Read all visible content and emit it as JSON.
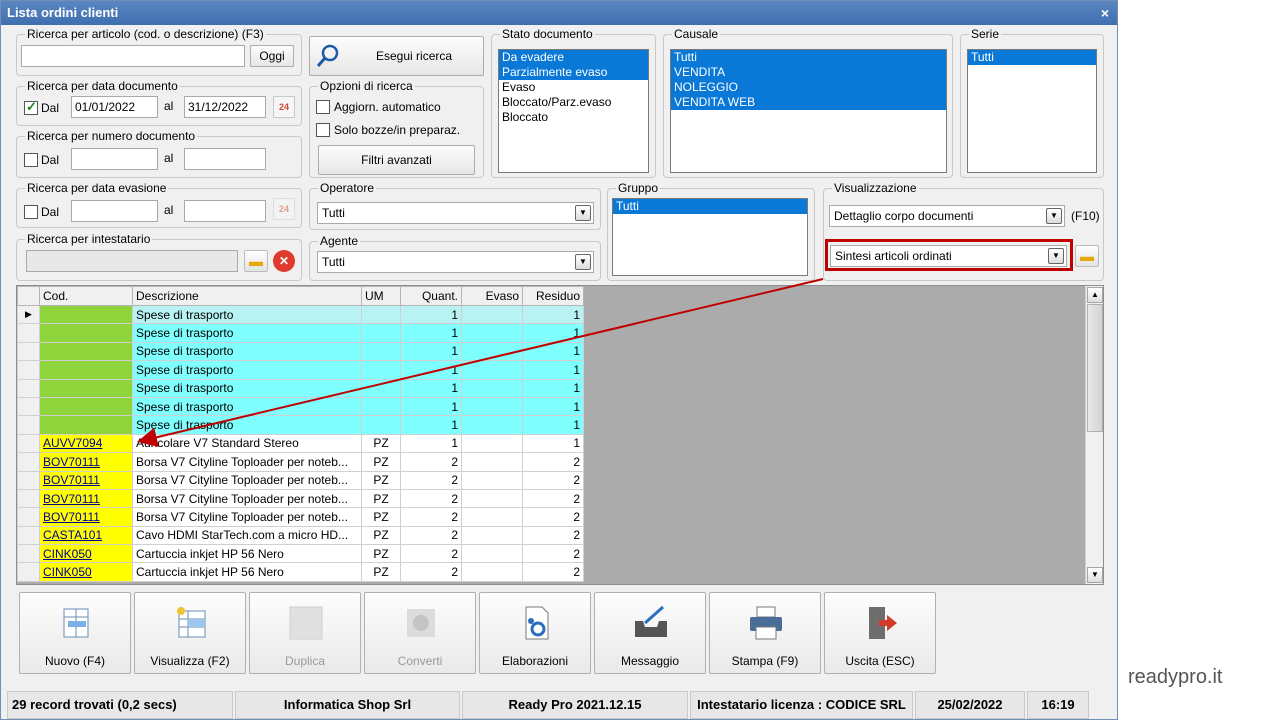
{
  "window": {
    "title": "Lista ordini clienti",
    "close": "×"
  },
  "ricerca_articolo": {
    "legend": "Ricerca per articolo (cod. o descrizione) (F3)",
    "value": "",
    "button": "Oggi"
  },
  "esegui": {
    "label": "Esegui ricerca"
  },
  "data_documento": {
    "legend": "Ricerca per data documento",
    "chk_label": "Dal",
    "checked": true,
    "from": "01/01/2022",
    "al": "al",
    "to": "31/12/2022"
  },
  "numero_documento": {
    "legend": "Ricerca per numero documento",
    "chk_label": "Dal",
    "from": "",
    "al": "al",
    "to": ""
  },
  "data_evasione": {
    "legend": "Ricerca per data evasione",
    "chk_label": "Dal",
    "from": "",
    "al": "al",
    "to": ""
  },
  "intestatario": {
    "legend": "Ricerca per intestatario",
    "value": ""
  },
  "opzioni": {
    "legend": "Opzioni di ricerca",
    "aggiorn": "Aggiorn. automatico",
    "bozze": "Solo bozze/in preparaz.",
    "filtri": "Filtri avanzati"
  },
  "stato": {
    "legend": "Stato documento",
    "items": [
      {
        "label": "Da evadere",
        "sel": true
      },
      {
        "label": "Parzialmente evaso",
        "sel": true
      },
      {
        "label": "Evaso",
        "sel": false
      },
      {
        "label": "Bloccato/Parz.evaso",
        "sel": false
      },
      {
        "label": "Bloccato",
        "sel": false
      }
    ]
  },
  "causale": {
    "legend": "Causale",
    "items": [
      {
        "label": "Tutti",
        "sel": true
      },
      {
        "label": "VENDITA",
        "sel": true
      },
      {
        "label": "NOLEGGIO",
        "sel": true
      },
      {
        "label": "VENDITA WEB",
        "sel": true
      }
    ]
  },
  "serie": {
    "legend": "Serie",
    "items": [
      {
        "label": "Tutti",
        "sel": true
      }
    ]
  },
  "operatore": {
    "legend": "Operatore",
    "value": "Tutti"
  },
  "agente": {
    "legend": "Agente",
    "value": "Tutti"
  },
  "gruppo": {
    "legend": "Gruppo",
    "items": [
      {
        "label": "Tutti",
        "sel": true
      }
    ]
  },
  "visualizzazione": {
    "legend": "Visualizzazione",
    "value": "Dettaglio corpo documenti",
    "shortcut": "(F10)",
    "secondary": "Sintesi articoli ordinati"
  },
  "grid": {
    "headers": [
      "Cod.",
      "Descrizione",
      "UM",
      "Quant.",
      "Evaso",
      "Residuo"
    ],
    "rows": [
      {
        "cod": "",
        "desc": "Spese di trasporto",
        "um": "",
        "quant": "1",
        "evaso": "",
        "residuo": "1",
        "style": "first"
      },
      {
        "cod": "",
        "desc": "Spese di trasporto",
        "um": "",
        "quant": "1",
        "evaso": "",
        "residuo": "1",
        "style": "cyan"
      },
      {
        "cod": "",
        "desc": "Spese di trasporto",
        "um": "",
        "quant": "1",
        "evaso": "",
        "residuo": "1",
        "style": "cyan"
      },
      {
        "cod": "",
        "desc": "Spese di trasporto",
        "um": "",
        "quant": "1",
        "evaso": "",
        "residuo": "1",
        "style": "cyan"
      },
      {
        "cod": "",
        "desc": "Spese di trasporto",
        "um": "",
        "quant": "1",
        "evaso": "",
        "residuo": "1",
        "style": "cyan"
      },
      {
        "cod": "",
        "desc": "Spese di trasporto",
        "um": "",
        "quant": "1",
        "evaso": "",
        "residuo": "1",
        "style": "cyan"
      },
      {
        "cod": "",
        "desc": "Spese di trasporto",
        "um": "",
        "quant": "1",
        "evaso": "",
        "residuo": "1",
        "style": "cyan"
      },
      {
        "cod": "AUVV7094",
        "desc": "Auricolare V7 Standard Stereo",
        "um": "PZ",
        "quant": "1",
        "evaso": "",
        "residuo": "1",
        "style": "yellow"
      },
      {
        "cod": "BOV70111",
        "desc": "Borsa V7 Cityline Toploader per noteb...",
        "um": "PZ",
        "quant": "2",
        "evaso": "",
        "residuo": "2",
        "style": "yellow"
      },
      {
        "cod": "BOV70111",
        "desc": "Borsa V7 Cityline Toploader per noteb...",
        "um": "PZ",
        "quant": "2",
        "evaso": "",
        "residuo": "2",
        "style": "yellow"
      },
      {
        "cod": "BOV70111",
        "desc": "Borsa V7 Cityline Toploader per noteb...",
        "um": "PZ",
        "quant": "2",
        "evaso": "",
        "residuo": "2",
        "style": "yellow"
      },
      {
        "cod": "BOV70111",
        "desc": "Borsa V7 Cityline Toploader per noteb...",
        "um": "PZ",
        "quant": "2",
        "evaso": "",
        "residuo": "2",
        "style": "yellow"
      },
      {
        "cod": "CASTA101",
        "desc": "Cavo HDMI StarTech.com a micro HD...",
        "um": "PZ",
        "quant": "2",
        "evaso": "",
        "residuo": "2",
        "style": "yellow"
      },
      {
        "cod": "CINK050",
        "desc": "Cartuccia inkjet HP 56 Nero",
        "um": "PZ",
        "quant": "2",
        "evaso": "",
        "residuo": "2",
        "style": "yellow"
      },
      {
        "cod": "CINK050",
        "desc": "Cartuccia inkjet HP 56 Nero",
        "um": "PZ",
        "quant": "2",
        "evaso": "",
        "residuo": "2",
        "style": "yellow"
      }
    ]
  },
  "toolbar": [
    {
      "label": "Nuovo (F4)",
      "icon": "new-icon",
      "enabled": true
    },
    {
      "label": "Visualizza (F2)",
      "icon": "view-icon",
      "enabled": true
    },
    {
      "label": "Duplica",
      "icon": "duplicate-icon",
      "enabled": false
    },
    {
      "label": "Converti",
      "icon": "convert-icon",
      "enabled": false
    },
    {
      "label": "Elaborazioni",
      "icon": "process-icon",
      "enabled": true
    },
    {
      "label": "Messaggio",
      "icon": "message-icon",
      "enabled": true
    },
    {
      "label": "Stampa (F9)",
      "icon": "print-icon",
      "enabled": true
    },
    {
      "label": "Uscita (ESC)",
      "icon": "exit-icon",
      "enabled": true
    }
  ],
  "status": {
    "records": "29 record trovati (0,2 secs)",
    "company": "Informatica Shop Srl",
    "version": "Ready Pro 2021.12.15",
    "license": "Intestatario licenza : CODICE SRL",
    "date": "25/02/2022",
    "time": "16:19"
  },
  "watermark": "readypro.it",
  "colors": {
    "title": "#4a7bbd",
    "selection": "#0a78d7",
    "cyan_row": "#80ffff",
    "green_cell": "#8ed43a",
    "yellow_cell": "#ffff00",
    "highlight_box": "#c00000"
  }
}
